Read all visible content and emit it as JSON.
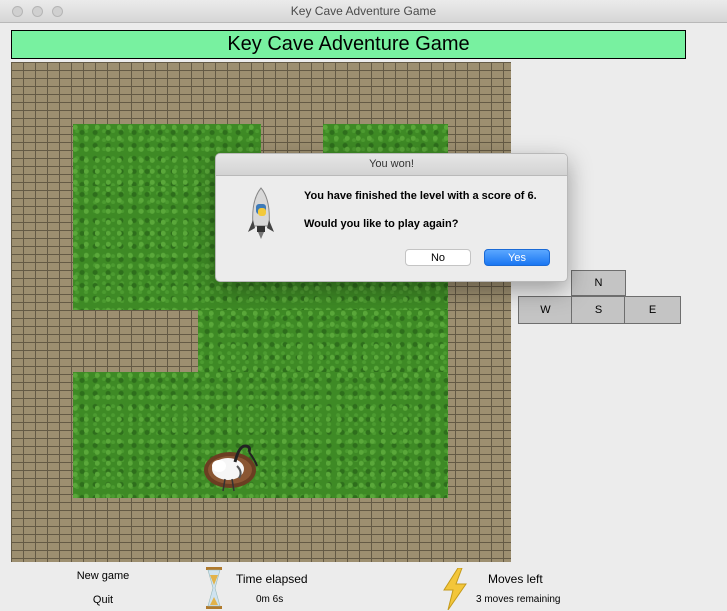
{
  "window": {
    "title": "Key Cave Adventure Game"
  },
  "banner": {
    "title": "Key Cave Adventure Game"
  },
  "compass": {
    "north": "N",
    "west": "W",
    "south": "S",
    "east": "E"
  },
  "dialog": {
    "title": "You won!",
    "message": "You have finished the level with a score of 6.",
    "question": "Would you like to play again?",
    "no_label": "No",
    "yes_label": "Yes",
    "icon": "python-rocket-icon"
  },
  "controls": {
    "new_game_label": "New game",
    "quit_label": "Quit"
  },
  "status": {
    "time_label": "Time elapsed",
    "time_value": "0m 6s",
    "time_icon": "hourglass-icon",
    "moves_label": "Moves left",
    "moves_value": "3 moves remaining",
    "moves_icon": "lightning-icon"
  },
  "colors": {
    "banner": "#78f1a0",
    "yes_button": "#1a76f2",
    "brick": "#9d8f70",
    "grass": "#3e8a25"
  }
}
